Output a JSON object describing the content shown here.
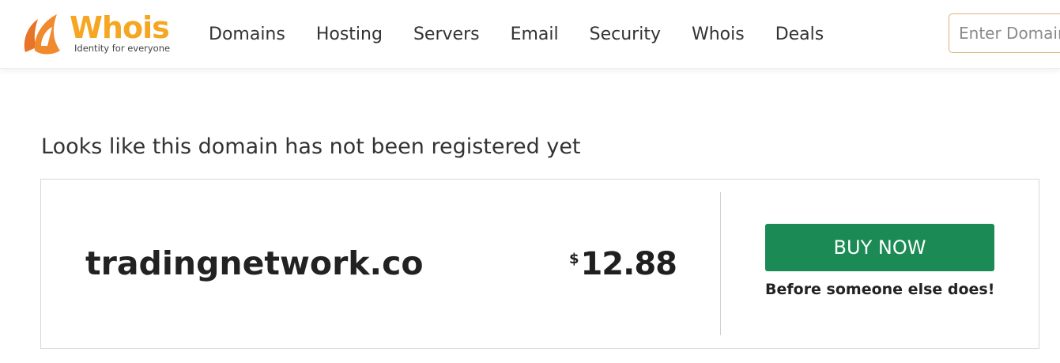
{
  "header": {
    "logo": {
      "word": "Whois",
      "tagline": "Identity for everyone",
      "icon": "whois-logo-icon"
    },
    "nav": [
      {
        "label": "Domains"
      },
      {
        "label": "Hosting"
      },
      {
        "label": "Servers"
      },
      {
        "label": "Email"
      },
      {
        "label": "Security"
      },
      {
        "label": "Whois"
      },
      {
        "label": "Deals"
      }
    ],
    "search": {
      "placeholder": "Enter Domain",
      "value": ""
    }
  },
  "main": {
    "headline": "Looks like this domain has not been registered yet",
    "result": {
      "domain": "tradingnetwork.co",
      "price_currency": "$",
      "price_amount": "12.88",
      "buy_label": "BUY NOW",
      "buy_subtext": "Before someone else does!"
    }
  },
  "colors": {
    "logo_orange": "#f5a623",
    "logo_mark": "#e8742a",
    "buy_button": "#1b8a55",
    "search_border": "#e0b07a"
  }
}
